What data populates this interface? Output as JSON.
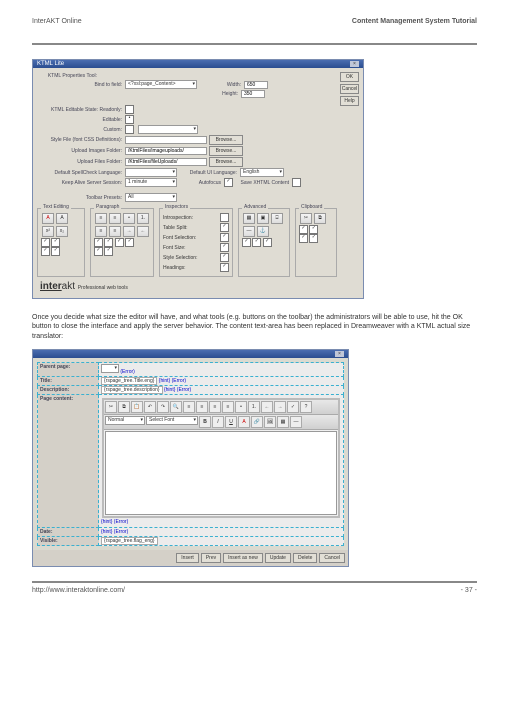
{
  "header": {
    "left": "InterAKT Online",
    "right": "Content Management System Tutorial"
  },
  "footer": {
    "left": "http://www.interaktonline.com/",
    "right": "- 37 -"
  },
  "para1": "Once you decide what size the editor will have, and what tools (e.g. buttons on the toolbar) the administrators will be able to use, hit the OK button to close the interface and apply the server behavior. The content text-area has been replaced in Dreamweaver with a KTML actual size translator:",
  "dlg1": {
    "title": "KTML Lite",
    "buttons": {
      "ok": "OK",
      "cancel": "Cancel",
      "help": "Help"
    },
    "propTool": "KTML Properties Tool:",
    "bindField": "Bind to field:",
    "bindVal": "<?xsl:page_Content>",
    "width": "Width:",
    "widthV": "650",
    "height": "Height:",
    "heightV": "350",
    "editState": "KTML Editable State: Readonly:",
    "editable": "Editable:",
    "custom": "Custom:",
    "styleFile": "Style File (font CSS Definitions):",
    "styleBtn": "Browse...",
    "imgFolder": "Upload Images Folder:",
    "imgVal": "/KtmlFiles/imageuploads/",
    "imgBtn": "Browse...",
    "fileFolder": "Upload Files Folder:",
    "fileVal": "/KtmlFiles/fileUploads/",
    "fileBtn": "Browse...",
    "spellLang": "Default SpellCheck Language:",
    "uiLang": "Default UI Language:",
    "uiVal": "English",
    "keepAlive": "Keep Alive Server Session:",
    "keepVal": "1 minute",
    "autofocus": "Autofocus",
    "saveXhtml": "Save XHTML Content",
    "presets": "Toolbar Presets:",
    "presetsV": "All",
    "cols": {
      "c1": "Text Editing",
      "c2": "Paragraph",
      "c3": "Inspectors",
      "c4": "Advanced",
      "c5": "Clipboard",
      "i1": "Introspection:",
      "i2": "Table Split:",
      "i3": "Font Selection:",
      "i4": "Font Size:",
      "i5": "Style Selection:",
      "i6": "Headings:"
    },
    "brand": "Professional web tools"
  },
  "dlg2": {
    "title": "",
    "rows": {
      "parent": "Parent page:",
      "title": "Title:",
      "desc": "Description:",
      "content": "Page content:",
      "date": "Date:",
      "visible": "Visible:"
    },
    "vals": {
      "parent": "(Error)",
      "titleV": "{rspage_tree.Title.eng}",
      "titleH": "{hint} (Error)",
      "descV": "{rspage_tree.description}",
      "descH": "{hint} (Error)",
      "dateV": "{hint} (Error)",
      "visV": "{rspage_tree.flag_eng}"
    },
    "ed": {
      "font": "Select Font",
      "normal": "Normal"
    },
    "btns": {
      "insert": "Insert",
      "prev": "Prev",
      "insertnew": "Insert as new",
      "update": "Update",
      "delete": "Delete",
      "cancel": "Cancel"
    }
  }
}
